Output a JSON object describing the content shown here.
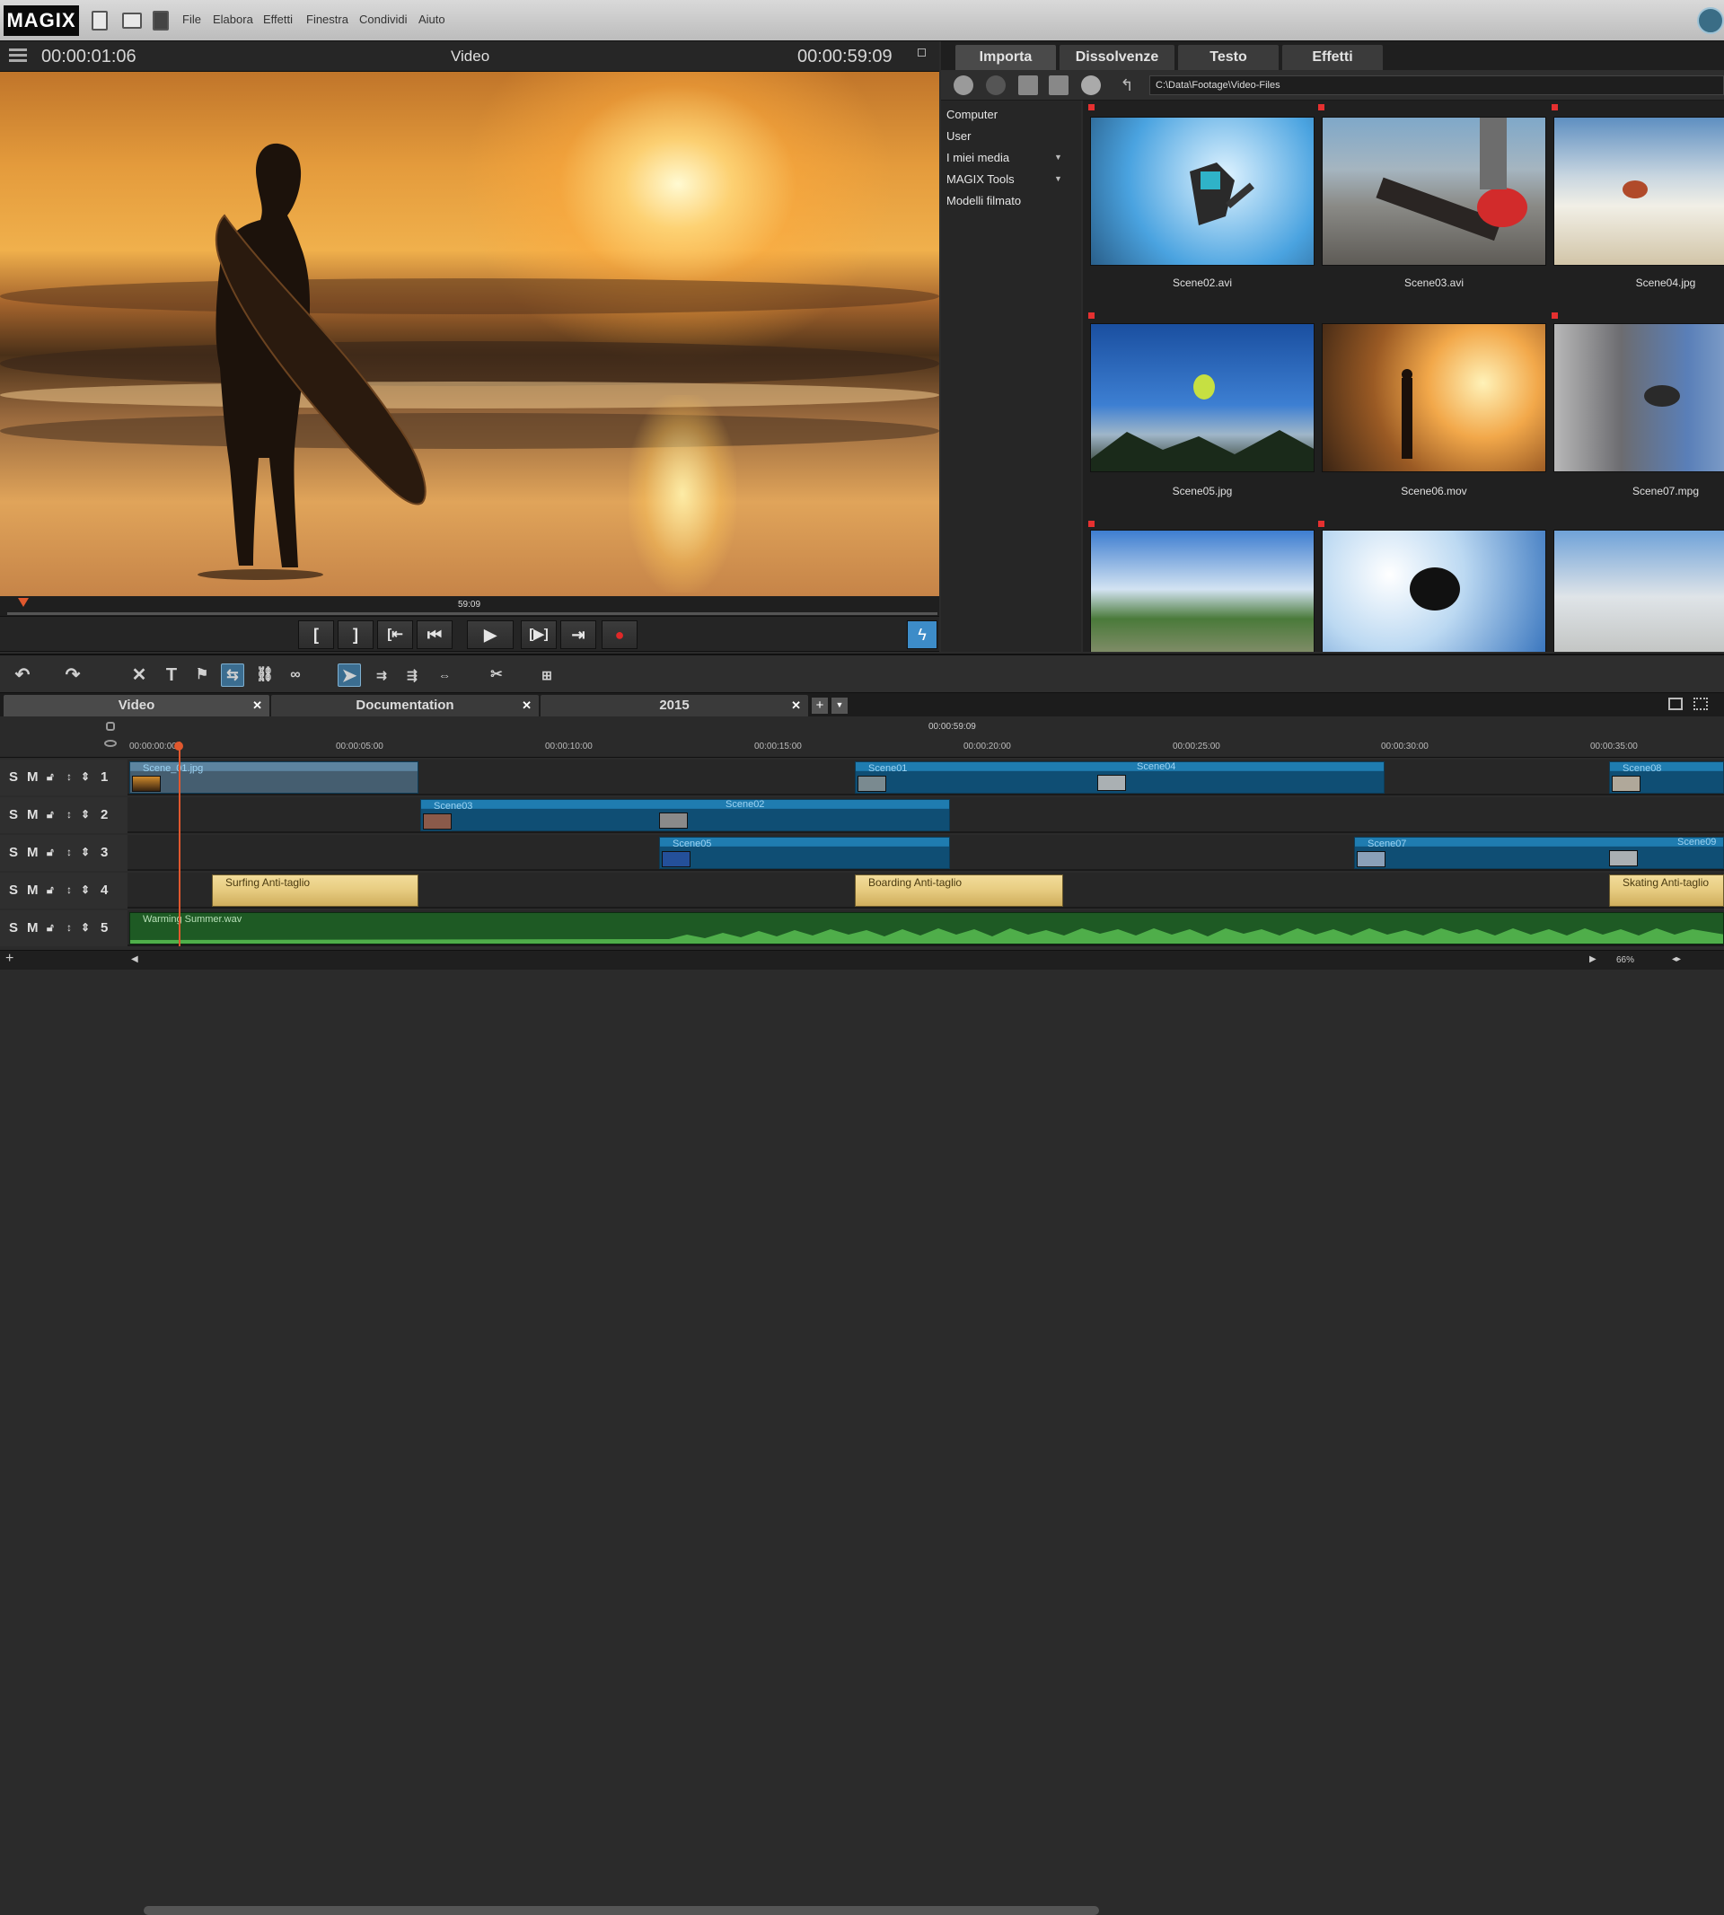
{
  "app": {
    "logo": "MAGIX",
    "brand_color": "#0b0b0b",
    "accent": "#3d8cc8"
  },
  "menu": [
    "File",
    "Elabora",
    "Effetti",
    "Finestra",
    "Condividi",
    "Aiuto"
  ],
  "preview": {
    "current_time": "00:00:01:06",
    "title": "Video",
    "duration": "00:00:59:09",
    "scrub_label": "59:09"
  },
  "import_panel": {
    "tabs": [
      "Importa",
      "Dissolvenze",
      "Testo",
      "Effetti"
    ],
    "active_tab": "Importa",
    "path": "C:\\Data\\Footage\\Video-Files",
    "tree": [
      {
        "label": "Computer",
        "expandable": false
      },
      {
        "label": "User",
        "expandable": false
      },
      {
        "label": "I miei media",
        "expandable": true
      },
      {
        "label": "MAGIX Tools",
        "expandable": true
      },
      {
        "label": "Modelli filmato",
        "expandable": false
      }
    ],
    "files": [
      {
        "name": "Scene02.avi",
        "marked": true
      },
      {
        "name": "Scene03.avi",
        "marked": true
      },
      {
        "name": "Scene04.jpg",
        "marked": true
      },
      {
        "name": "Scene05.jpg",
        "marked": true
      },
      {
        "name": "Scene06.mov",
        "marked": false
      },
      {
        "name": "Scene07.mpg",
        "marked": true
      },
      {
        "name": "",
        "marked": true
      },
      {
        "name": "",
        "marked": true
      },
      {
        "name": "",
        "marked": false
      }
    ]
  },
  "timeline": {
    "tabs": [
      "Video",
      "Documentation",
      "2015"
    ],
    "marker_time": "00:00:59:09",
    "ruler": [
      "00:00:00:00",
      "00:00:05:00",
      "00:00:10:00",
      "00:00:15:00",
      "00:00:20:00",
      "00:00:25:00",
      "00:00:30:00",
      "00:00:35:00"
    ],
    "track_controls": [
      "S",
      "M"
    ],
    "tracks": [
      {
        "number": "1",
        "clips": [
          "Scene_01.jpg",
          "Scene01",
          "Scene04",
          "Scene08"
        ]
      },
      {
        "number": "2",
        "clips": [
          "Scene03",
          "Scene02"
        ]
      },
      {
        "number": "3",
        "clips": [
          "Scene05",
          "Scene07",
          "Scene09"
        ]
      },
      {
        "number": "4",
        "clips": [
          "Surfing   Anti-taglio",
          "Boarding   Anti-taglio",
          "Skating   Anti-taglio"
        ]
      },
      {
        "number": "5",
        "clips": [
          "Warming Summer.wav"
        ]
      }
    ],
    "zoom": "66%"
  }
}
